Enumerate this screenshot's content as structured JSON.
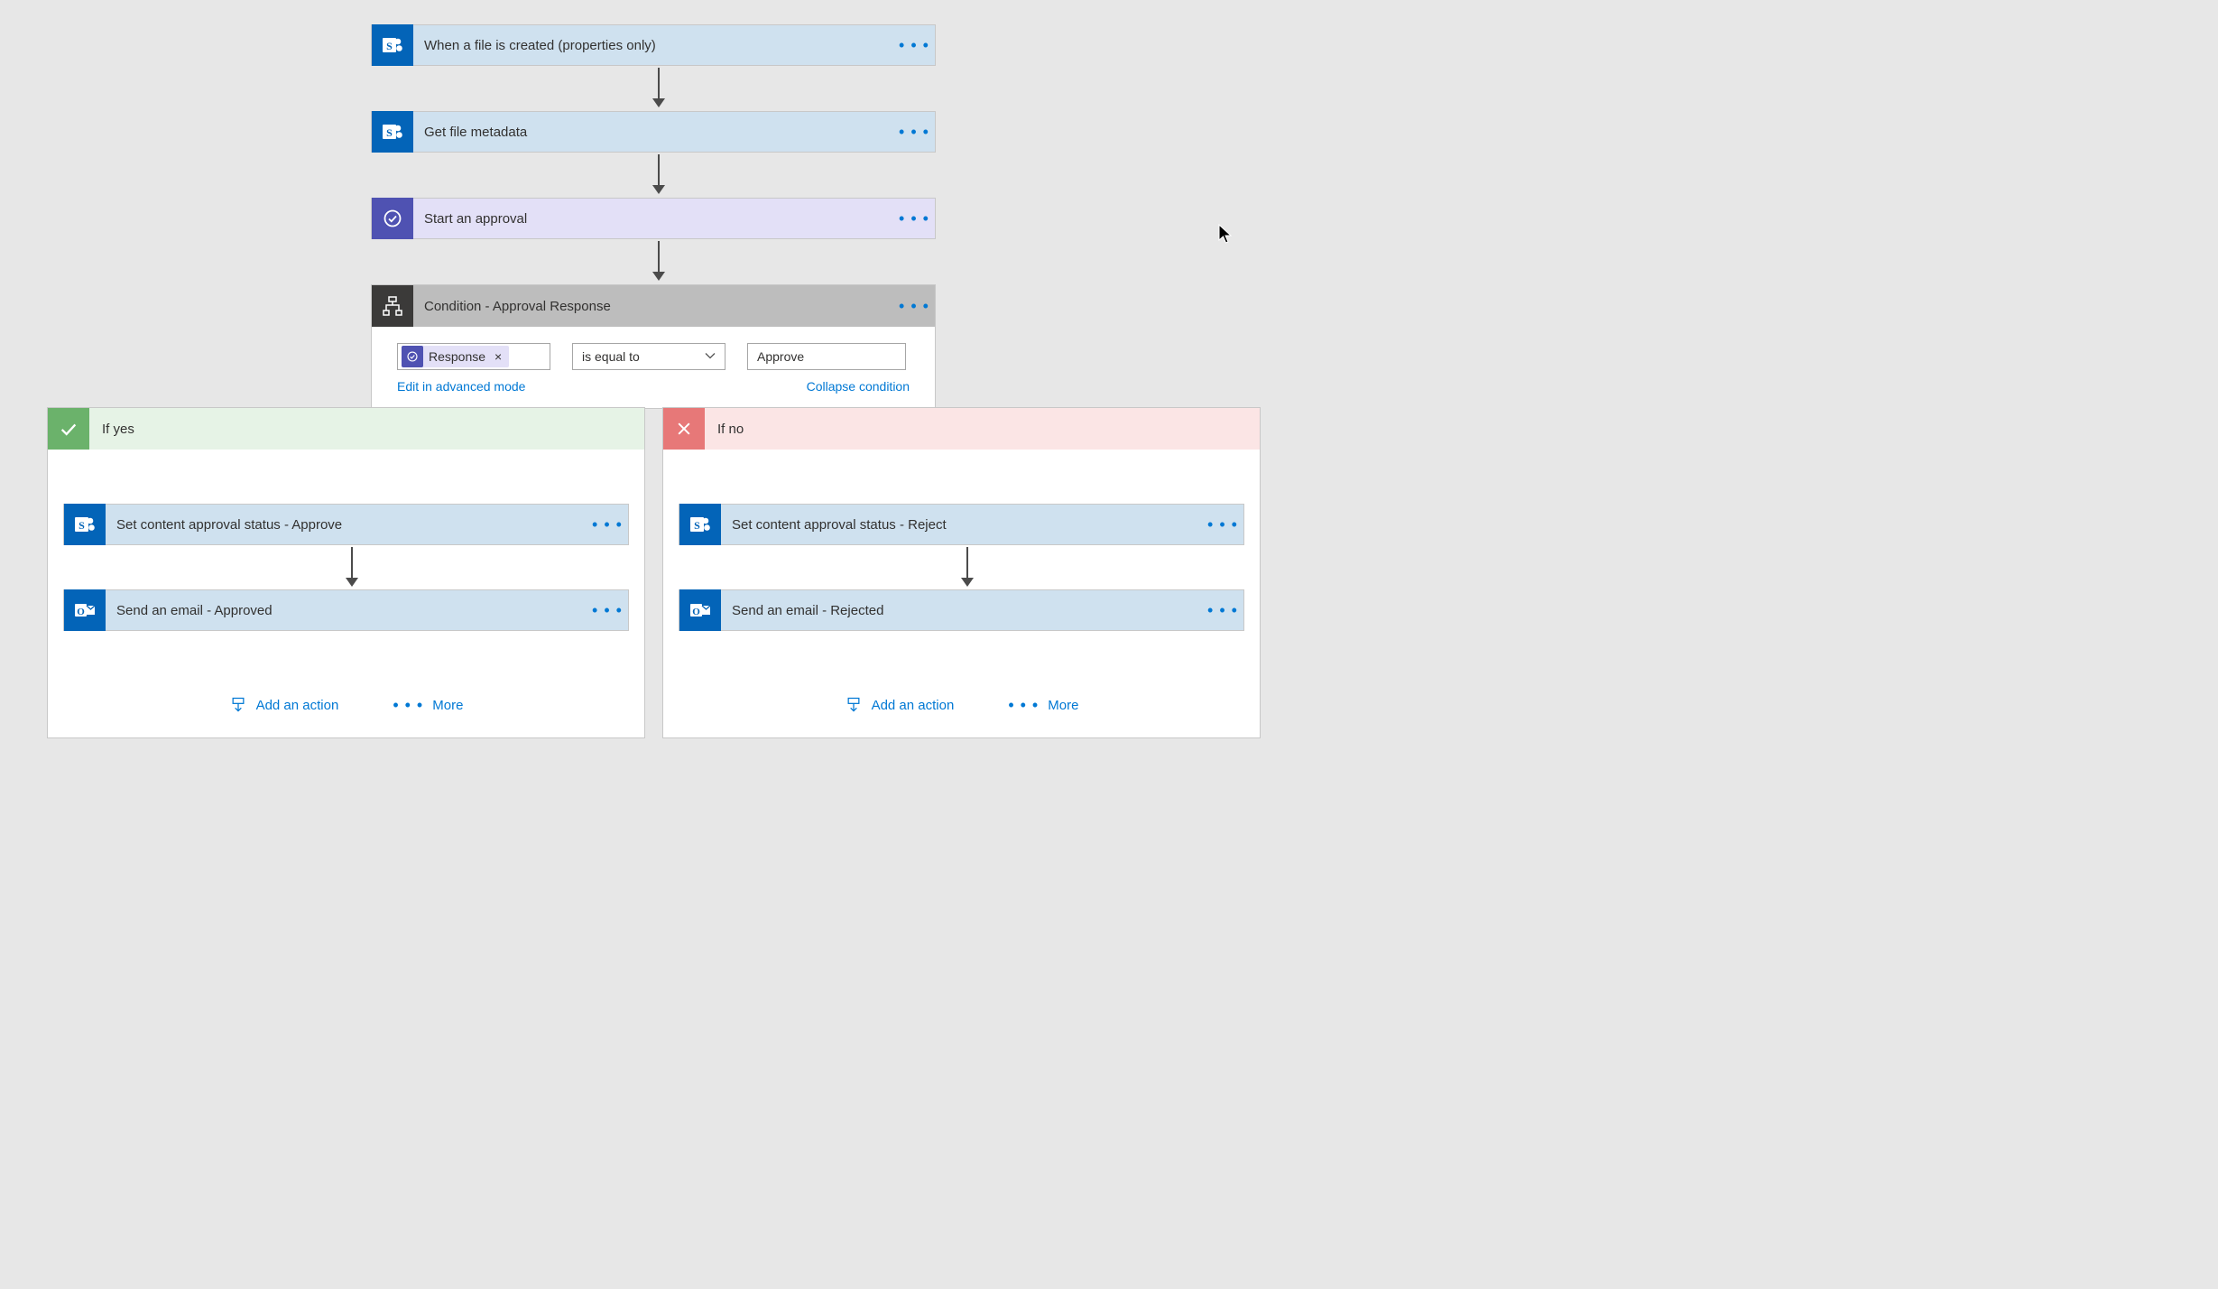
{
  "steps": {
    "trigger": {
      "title": "When a file is created (properties only)"
    },
    "metadata": {
      "title": "Get file metadata"
    },
    "approval": {
      "title": "Start an approval"
    }
  },
  "condition": {
    "title": "Condition - Approval Response",
    "pill_label": "Response",
    "operator": "is equal to",
    "value": "Approve",
    "edit_link": "Edit in advanced mode",
    "collapse_link": "Collapse condition"
  },
  "branches": {
    "yes": {
      "label": "If yes",
      "step1": "Set content approval status - Approve",
      "step2": "Send an email - Approved"
    },
    "no": {
      "label": "If no",
      "step1": "Set content approval status - Reject",
      "step2": "Send an email - Rejected"
    }
  },
  "actions": {
    "add": "Add an action",
    "more": "More"
  },
  "colors": {
    "sharepoint": "#0364b8",
    "approval": "#4f52b2",
    "link": "#0078d4",
    "yes": "#6bb26b",
    "no": "#e77878"
  }
}
